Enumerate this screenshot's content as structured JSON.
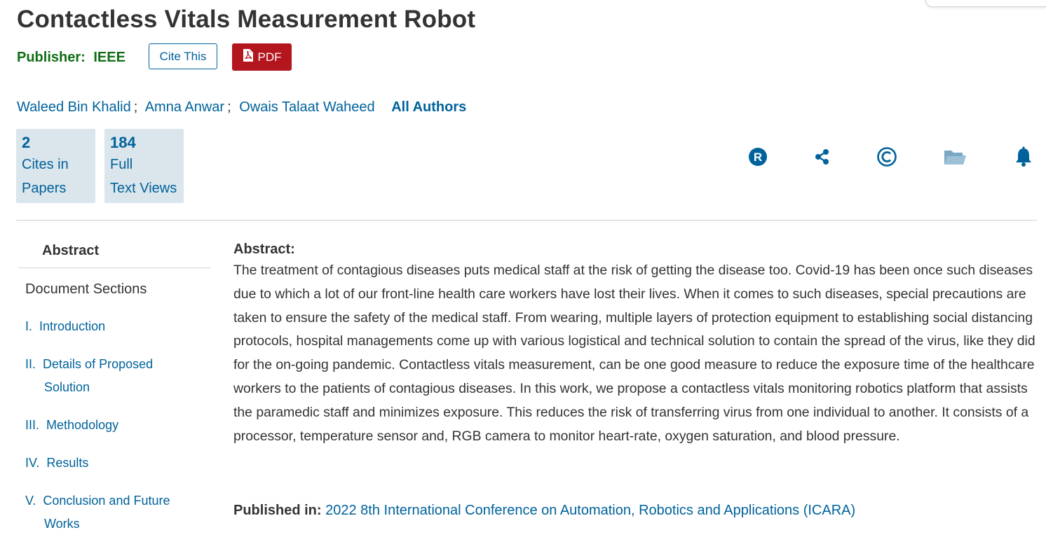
{
  "title": "Contactless Vitals Measurement Robot",
  "publisher": {
    "label": "Publisher:",
    "value": "IEEE"
  },
  "buttons": {
    "cite": "Cite This",
    "pdf": "PDF"
  },
  "authors": [
    {
      "name": "Waleed Bin Khalid",
      "sep": ";"
    },
    {
      "name": "Amna Anwar",
      "sep": ";"
    },
    {
      "name": "Owais Talaat Waheed"
    }
  ],
  "all_authors": "All Authors",
  "metrics": [
    {
      "value": "2",
      "label_line1": "Cites in",
      "label_line2": "Papers"
    },
    {
      "value": "184",
      "label_line1": "Full",
      "label_line2": "Text Views"
    }
  ],
  "toolbar_icons": [
    "rights-icon",
    "share-icon",
    "copyright-icon",
    "folder-icon",
    "bell-icon"
  ],
  "colors": {
    "link": "#00629b",
    "publisher": "#0f6e14",
    "pdf": "#b3161d",
    "metric_bg": "#dbe5ec"
  },
  "sidebar": {
    "abstract": "Abstract",
    "sections_title": "Document Sections",
    "items": [
      {
        "num": "I.",
        "line1": "Introduction"
      },
      {
        "num": "II.",
        "line1": "Details of Proposed",
        "line2": "Solution"
      },
      {
        "num": "III.",
        "line1": "Methodology"
      },
      {
        "num": "IV.",
        "line1": "Results"
      },
      {
        "num": "V.",
        "line1": "Conclusion and Future",
        "line2": "Works"
      }
    ]
  },
  "abstract": {
    "heading": "Abstract:",
    "text": "The treatment of contagious diseases puts medical staff at the risk of getting the disease too. Covid-19 has been once such diseases due to which a lot of our front-line health care workers have lost their lives. When it comes to such diseases, special precautions are taken to ensure the safety of the medical staff. From wearing, multiple layers of protection equipment to establishing social distancing protocols, hospital managements come up with various logistical and technical solution to contain the spread of the virus, like they did for the on-going pandemic. Contactless vitals measurement, can be one good measure to reduce the exposure time of the healthcare workers to the patients of contagious diseases. In this work, we propose a contactless vitals monitoring robotics platform that assists the paramedic staff and minimizes exposure. This reduces the risk of transferring virus from one individual to another. It consists of a processor, temperature sensor and, RGB camera to monitor heart-rate, oxygen saturation, and blood pressure."
  },
  "published": {
    "label": "Published in:",
    "venue": "2022 8th International Conference on Automation, Robotics and Applications (ICARA)"
  }
}
